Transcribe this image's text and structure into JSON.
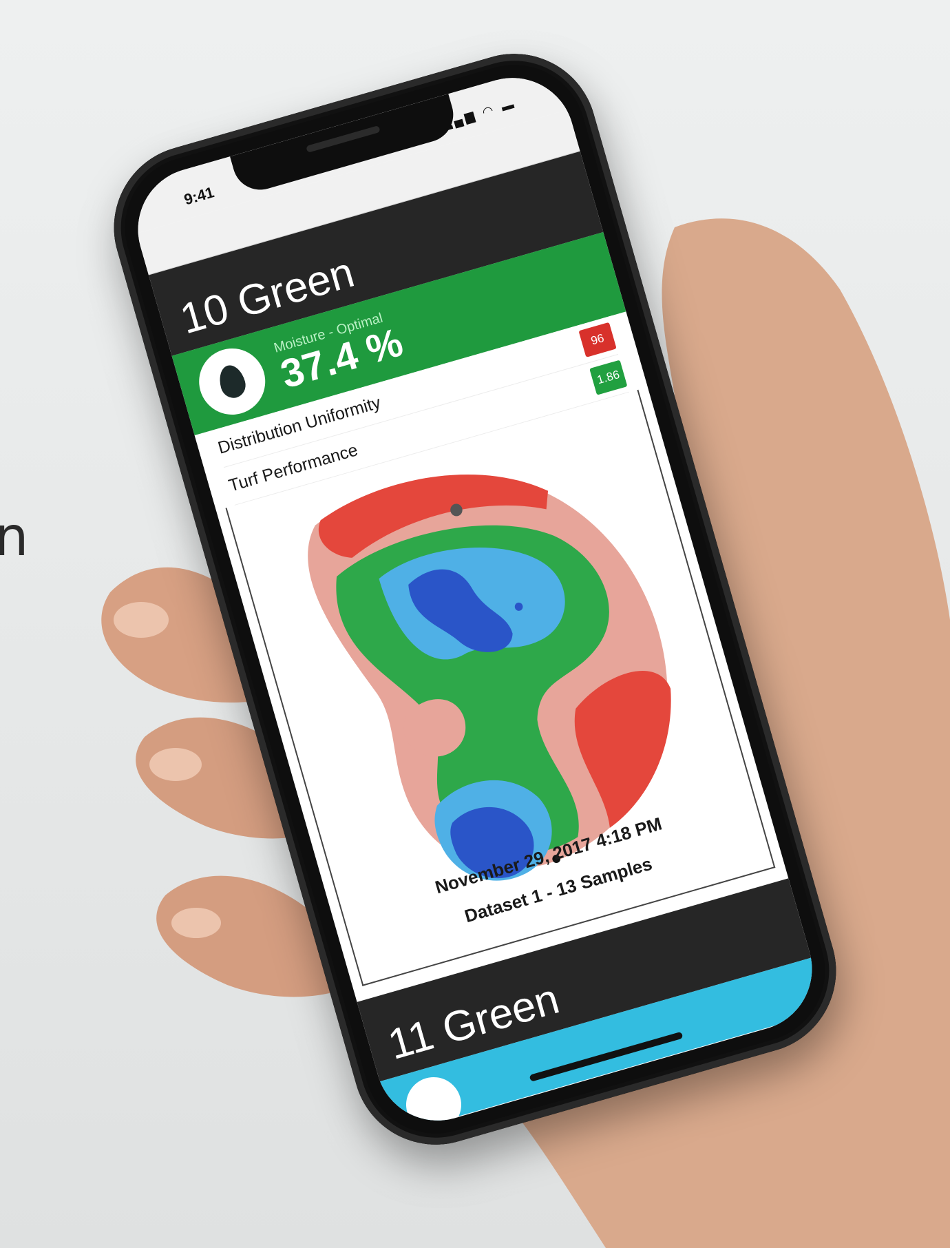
{
  "status_bar": {
    "time": "9:41",
    "icons": "▂▄▆ ◠ ▬"
  },
  "browser": {
    "url": "",
    "url_redacted": ""
  },
  "cards": [
    {
      "title": "10 Green",
      "moisture_label": "Moisture - Optimal",
      "moisture_value": "37.4 %",
      "metrics": [
        {
          "label": "Distribution Uniformity",
          "badge": "96",
          "badge_color": "#d8312b"
        },
        {
          "label": "Turf Performance",
          "badge": "1.86",
          "badge_color": "#21a040"
        }
      ],
      "map_caption_date": "November 29, 2017 4:18 PM",
      "map_caption_dataset": "Dataset 1 - 13 Samples"
    },
    {
      "title": "11 Green",
      "accent": "#33bde0"
    }
  ],
  "colors": {
    "header_dark": "#262626",
    "moisture_green": "#1f9a3e",
    "map_dark_blue": "#2a55c8",
    "map_light_blue": "#4fb0e6",
    "map_green": "#2ea84a",
    "map_pink": "#e7a59a",
    "map_red": "#e4473c"
  },
  "left_edge_glyph": "n"
}
